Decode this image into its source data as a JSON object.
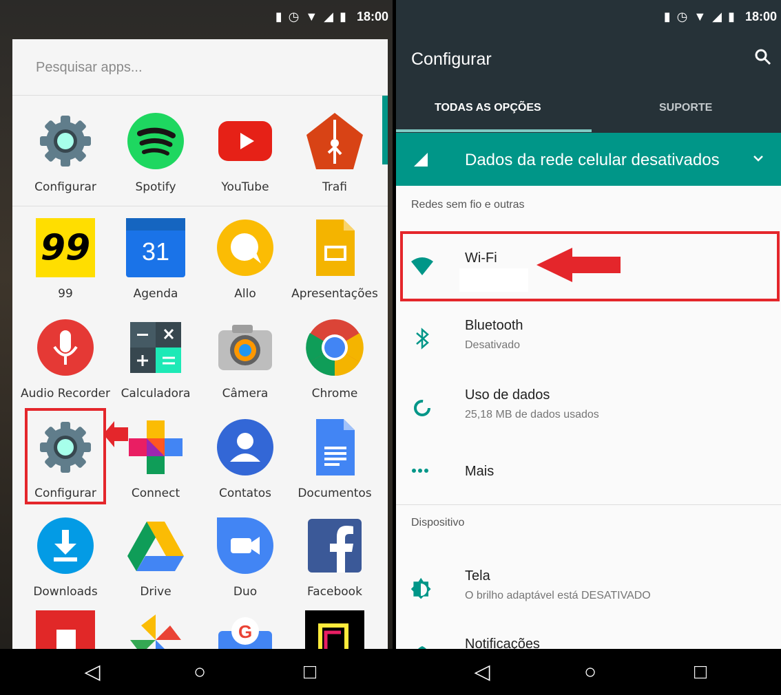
{
  "left": {
    "status": {
      "time": "18:00"
    },
    "search_placeholder": "Pesquisar apps...",
    "apps": [
      {
        "label": "Configurar",
        "icon": "settings-gear-icon"
      },
      {
        "label": "Spotify",
        "icon": "spotify-icon"
      },
      {
        "label": "YouTube",
        "icon": "youtube-icon"
      },
      {
        "label": "Trafi",
        "icon": "trafi-icon"
      },
      {
        "label": "99",
        "icon": "app-99-icon",
        "icon_text": "99"
      },
      {
        "label": "Agenda",
        "icon": "calendar-icon",
        "icon_text": "31"
      },
      {
        "label": "Allo",
        "icon": "allo-icon"
      },
      {
        "label": "Apresentações",
        "icon": "slides-icon"
      },
      {
        "label": "Audio Recorder",
        "icon": "microphone-icon"
      },
      {
        "label": "Calculadora",
        "icon": "calculator-icon"
      },
      {
        "label": "Câmera",
        "icon": "camera-icon"
      },
      {
        "label": "Chrome",
        "icon": "chrome-icon"
      },
      {
        "label": "Configurar",
        "icon": "settings-gear-icon"
      },
      {
        "label": "Connect",
        "icon": "connect-icon"
      },
      {
        "label": "Contatos",
        "icon": "contacts-icon"
      },
      {
        "label": "Documentos",
        "icon": "docs-icon"
      },
      {
        "label": "Downloads",
        "icon": "download-icon"
      },
      {
        "label": "Drive",
        "icon": "drive-icon"
      },
      {
        "label": "Duo",
        "icon": "duo-icon"
      },
      {
        "label": "Facebook",
        "icon": "facebook-icon"
      }
    ],
    "colors": {
      "highlight": "#e4262b",
      "accent": "#009688"
    }
  },
  "right": {
    "status": {
      "time": "18:00"
    },
    "title": "Configurar",
    "tabs": [
      "TODAS AS OPÇÕES",
      "SUPORTE"
    ],
    "banner": "Dados da rede celular desativados",
    "sections": [
      "Redes sem fio e outras",
      "Dispositivo"
    ],
    "items": [
      {
        "title": "Wi-Fi",
        "subtitle": ""
      },
      {
        "title": "Bluetooth",
        "subtitle": "Desativado"
      },
      {
        "title": "Uso de dados",
        "subtitle": "25,18 MB de dados usados"
      },
      {
        "title": "Mais",
        "subtitle": ""
      },
      {
        "title": "Tela",
        "subtitle": "O brilho adaptável está DESATIVADO"
      },
      {
        "title": "Notificações",
        "subtitle": ""
      }
    ],
    "colors": {
      "header": "#263238",
      "teal": "#009688",
      "highlight": "#e4262b"
    }
  }
}
